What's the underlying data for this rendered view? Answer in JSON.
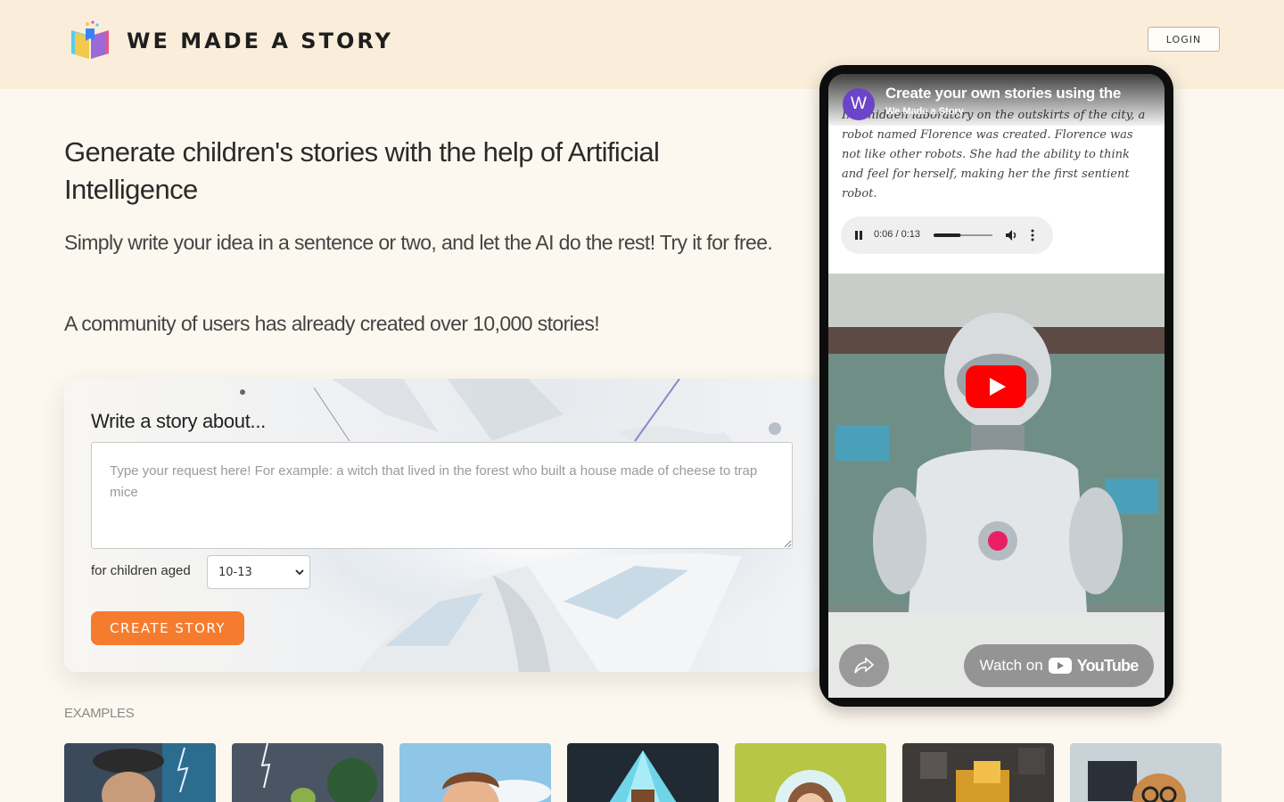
{
  "header": {
    "brand": "WE MADE A STORY",
    "login_label": "LOGIN"
  },
  "hero": {
    "headline": "Generate children's stories with the help of Artificial Intelligence",
    "subhead": "Simply write your idea in a sentence or two, and let the AI do the rest! Try it for free.",
    "community": "A community of users has already created over 10,000 stories!"
  },
  "form": {
    "title": "Write a story about...",
    "placeholder": "Type your request here! For example: a witch that lived in the forest who built a house made of cheese to trap mice",
    "age_label": "for children aged",
    "age_selected": "10-13",
    "submit_label": "CREATE STORY"
  },
  "examples": {
    "label": "EXAMPLES"
  },
  "video": {
    "channel_initial": "W",
    "title": "Create your own stories using the",
    "channel": "We Made a Story",
    "story_text": "In a hidden laboratory on the outskirts of the city, a robot named Florence was created. Florence was not like other robots. She had the ability to think and feel for herself, making her the first sentient robot.",
    "audio_time": "0:06 / 0:13",
    "audio_progress": 0.46,
    "watch_on": "Watch on",
    "youtube": "YouTube"
  },
  "colors": {
    "header_bg": "#faeedb",
    "page_bg": "#fdf8ef",
    "accent": "#f57c2f",
    "youtube_red": "#ff0000",
    "avatar": "#6b44c9"
  }
}
